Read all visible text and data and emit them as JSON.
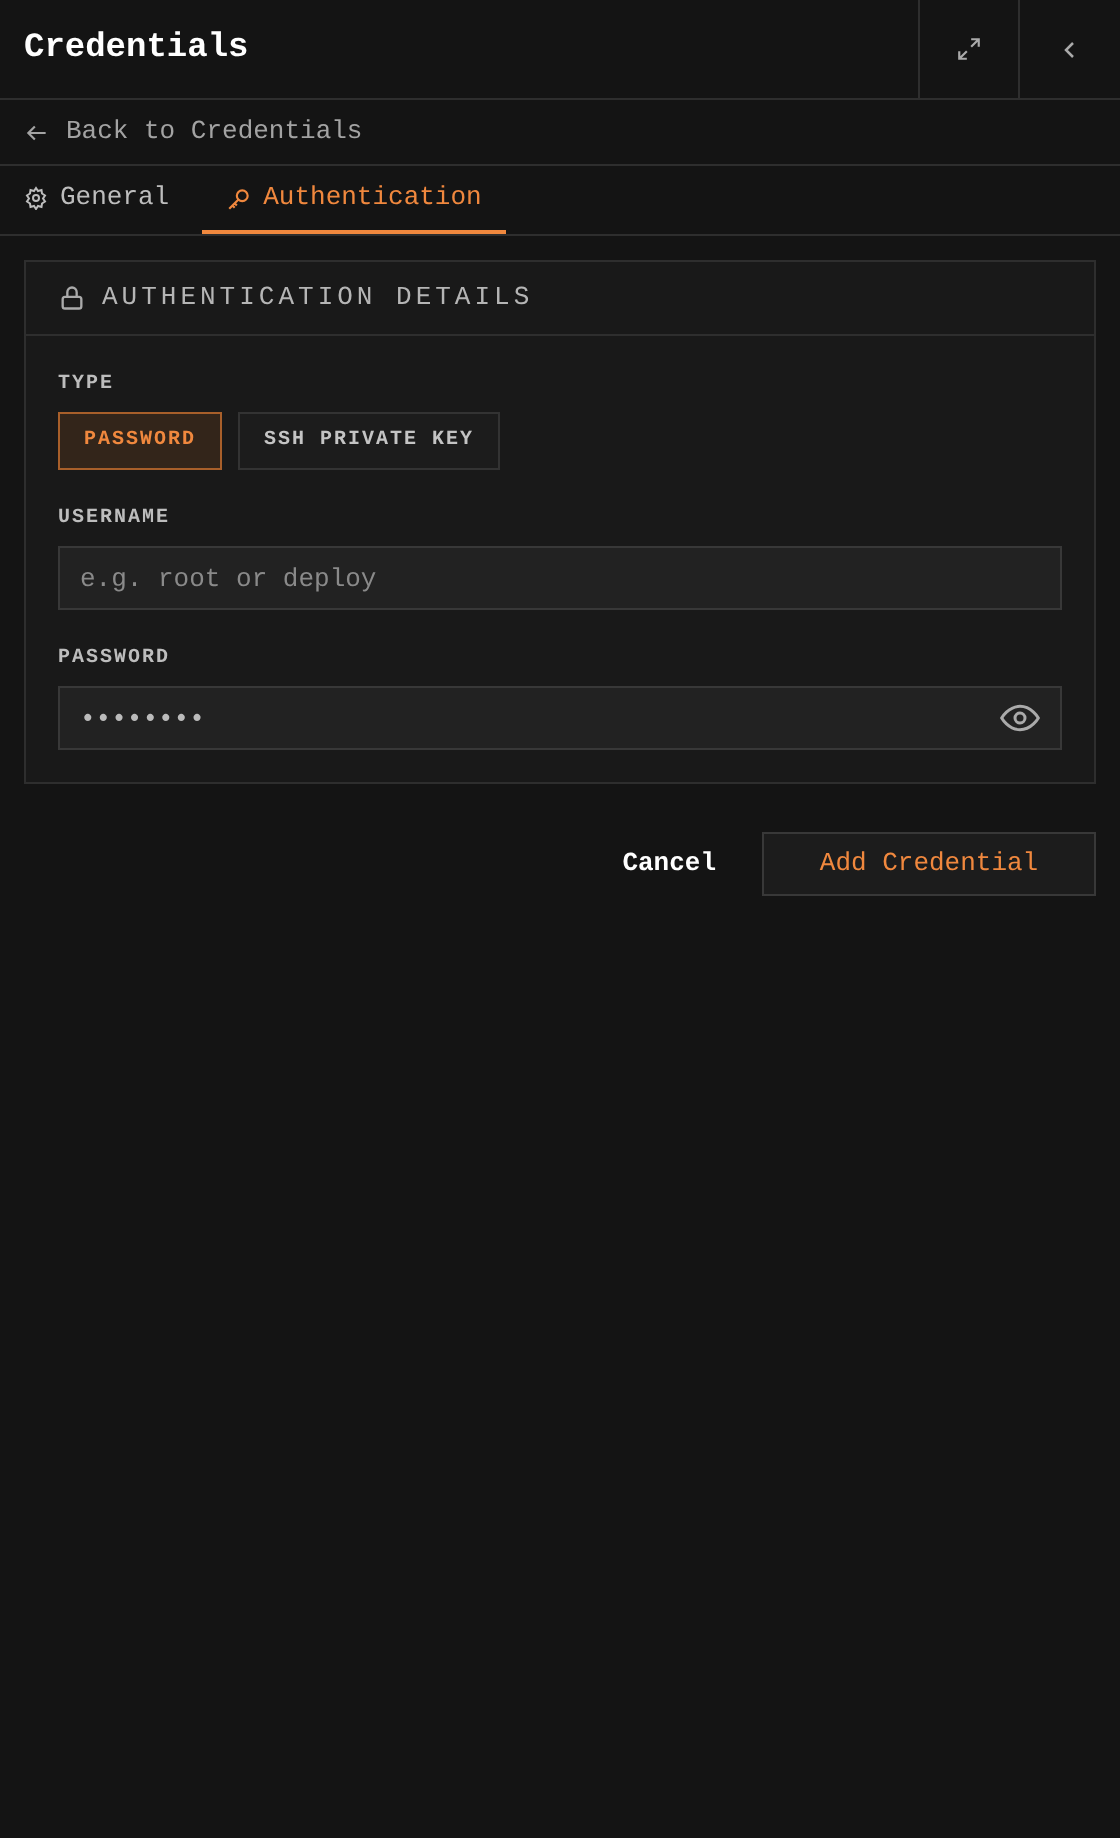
{
  "header": {
    "title": "Credentials"
  },
  "back_link": "Back to Credentials",
  "tabs": [
    {
      "label": "General",
      "selected": false
    },
    {
      "label": "Authentication",
      "selected": true
    }
  ],
  "card": {
    "title": "AUTHENTICATION DETAILS",
    "type_label": "TYPE",
    "type_options": [
      {
        "label": "PASSWORD",
        "selected": true
      },
      {
        "label": "SSH PRIVATE KEY",
        "selected": false
      }
    ],
    "username": {
      "label": "USERNAME",
      "placeholder": "e.g. root or deploy"
    },
    "password": {
      "label": "PASSWORD",
      "value": "••••••••"
    }
  },
  "actions": {
    "cancel": "Cancel",
    "submit": "Add Credential"
  }
}
